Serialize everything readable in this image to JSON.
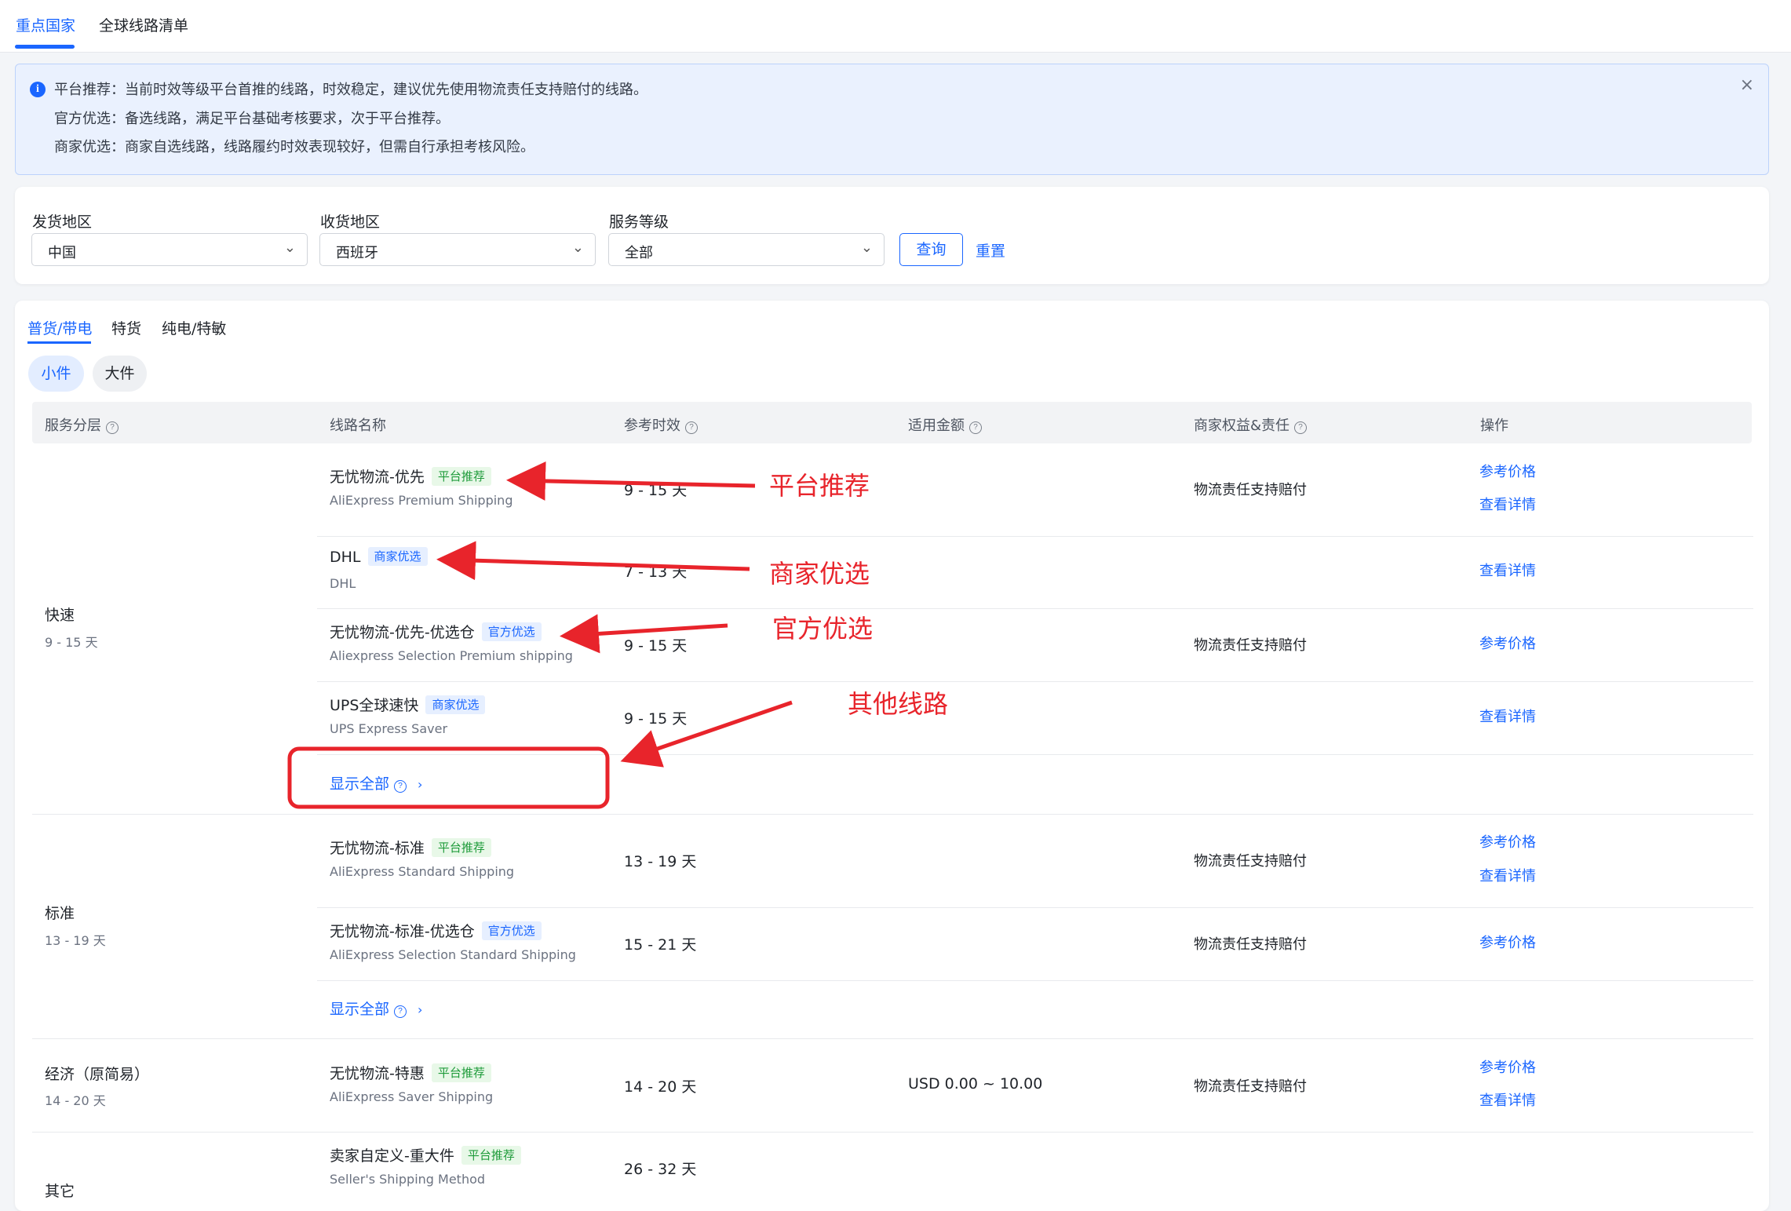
{
  "top_tabs": [
    "重点国家",
    "全球线路清单"
  ],
  "notice": {
    "lines": [
      "平台推荐：当前时效等级平台首推的线路，时效稳定，建议优先使用物流责任支持赔付的线路。",
      "官方优选：备选线路，满足平台基础考核要求，次于平台推荐。",
      "商家优选：商家自选线路，线路履约时效表现较好，但需自行承担考核风险。"
    ],
    "close_icon": "×",
    "info_icon": "i"
  },
  "filters": {
    "origin": {
      "label": "发货地区",
      "value": "中国"
    },
    "destination": {
      "label": "收货地区",
      "value": "西班牙"
    },
    "service_level": {
      "label": "服务等级",
      "value": "全部"
    },
    "chevron": "⌄",
    "query_label": "查询",
    "reset_label": "重置"
  },
  "category_tabs": [
    "普货/带电",
    "特货",
    "纯电/特敏"
  ],
  "size_pills": [
    "小件",
    "大件"
  ],
  "table": {
    "headers": [
      "服务分层",
      "线路名称",
      "参考时效",
      "适用金额",
      "商家权益&责任",
      "操作"
    ],
    "help_icon": "?",
    "show_all_label": "显示全部",
    "show_all_arrow": "›",
    "tiers": [
      {
        "name": "快速",
        "days": "9 - 15 天"
      },
      {
        "name": "标准",
        "days": "13 - 19 天"
      },
      {
        "name": "经济（原简易）",
        "days": "14 - 20 天"
      },
      {
        "name": "其它",
        "days": ""
      }
    ],
    "routes": [
      {
        "name": "无忧物流-优先",
        "tag": "平台推荐",
        "sub": "AliExpress Premium Shipping",
        "time": "9 - 15 天",
        "amount": "",
        "rights": "物流责任支持赔付",
        "link1": "参考价格",
        "link2": "查看详情"
      },
      {
        "name": "DHL",
        "tag": "商家优选",
        "sub": "DHL",
        "time": "7 - 13 天",
        "amount": "",
        "rights": "",
        "link1": "查看详情",
        "link2": ""
      },
      {
        "name": "无忧物流-优先-优选仓",
        "tag": "官方优选",
        "sub": "Aliexpress Selection Premium shipping",
        "time": "9 - 15 天",
        "amount": "",
        "rights": "物流责任支持赔付",
        "link1": "参考价格",
        "link2": ""
      },
      {
        "name": "UPS全球速快",
        "tag": "商家优选",
        "sub": "UPS Express Saver",
        "time": "9 - 15 天",
        "amount": "",
        "rights": "",
        "link1": "查看详情",
        "link2": ""
      },
      {
        "name": "无忧物流-标准",
        "tag": "平台推荐",
        "sub": "AliExpress Standard Shipping",
        "time": "13 - 19 天",
        "amount": "",
        "rights": "物流责任支持赔付",
        "link1": "参考价格",
        "link2": "查看详情"
      },
      {
        "name": "无忧物流-标准-优选仓",
        "tag": "官方优选",
        "sub": "AliExpress Selection Standard Shipping",
        "time": "15 - 21 天",
        "amount": "",
        "rights": "物流责任支持赔付",
        "link1": "参考价格",
        "link2": ""
      },
      {
        "name": "无忧物流-特惠",
        "tag": "平台推荐",
        "sub": "AliExpress Saver Shipping",
        "time": "14 - 20 天",
        "amount": "USD 0.00 ~ 10.00",
        "rights": "物流责任支持赔付",
        "link1": "参考价格",
        "link2": "查看详情"
      },
      {
        "name": "卖家自定义-重大件",
        "tag": "平台推荐",
        "sub": "Seller's Shipping Method",
        "time": "26 - 32 天",
        "amount": "",
        "rights": "",
        "link1": "",
        "link2": ""
      }
    ]
  },
  "annotations": {
    "labels": [
      "平台推荐",
      "商家优选",
      "官方优选",
      "其他线路"
    ],
    "color": "#e8242b"
  },
  "colors": {
    "accent": "#1a66ff",
    "tag_green": "#1e9b3a",
    "tag_blue": "#1a66ff",
    "annotation": "#e8242b"
  }
}
